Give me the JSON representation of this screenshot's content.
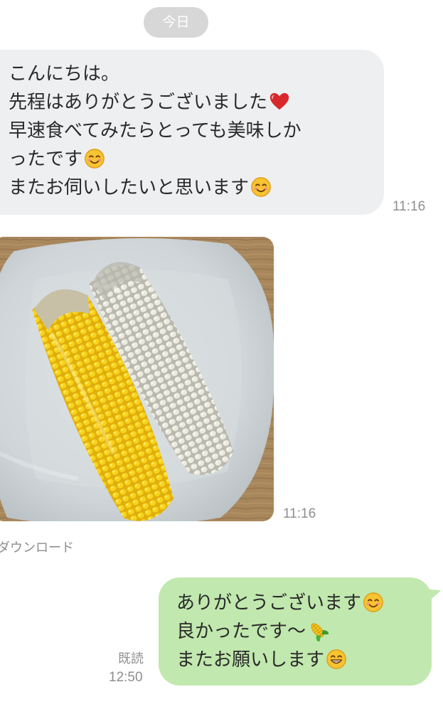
{
  "date_separator": "今日",
  "incoming": {
    "lines": [
      "こんにちは。",
      "先程はありがとうございました",
      "早速食べてみたらとっても美味しか",
      "ったです",
      "またお伺いしたいと思います"
    ],
    "line_icons": [
      "",
      "red-heart-icon",
      "",
      "smiling-face-icon",
      "smiling-face-icon"
    ],
    "time": "11:16"
  },
  "photo": {
    "icon": "corn-on-plate-photo",
    "time": "11:16",
    "download_label": "ダウンロード"
  },
  "outgoing": {
    "lines": [
      "ありがとうございます",
      "良かったです〜",
      "またお願いします"
    ],
    "line_icons": [
      "smiling-face-icon",
      "corn-icon",
      "grinning-face-icon"
    ],
    "read_label": "既読",
    "time": "12:50"
  },
  "colors": {
    "incoming_bubble": "#eeeff1",
    "outgoing_bubble": "#c1e8ae",
    "date_pill": "#d7d7d7",
    "meta_text": "#8e8e8e"
  }
}
